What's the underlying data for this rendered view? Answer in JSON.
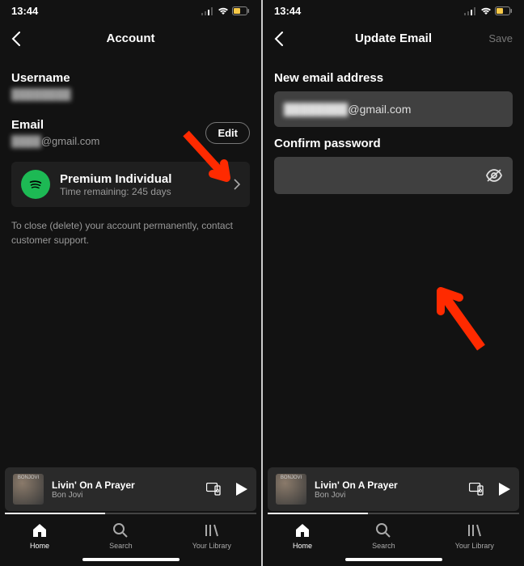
{
  "status": {
    "time": "13:44"
  },
  "left": {
    "header_title": "Account",
    "username_label": "Username",
    "username_value": "████████",
    "email_label": "Email",
    "email_value_prefix": "████",
    "email_value_suffix": "@gmail.com",
    "edit_label": "Edit",
    "plan_title": "Premium Individual",
    "plan_sub": "Time remaining: 245 days",
    "close_text": "To close (delete) your account permanently, contact customer support."
  },
  "right": {
    "header_title": "Update Email",
    "save_label": "Save",
    "new_email_label": "New email address",
    "new_email_value_prefix": "████████",
    "new_email_value_suffix": "@gmail.com",
    "confirm_label": "Confirm password"
  },
  "now_playing": {
    "song": "Livin' On A Prayer",
    "artist": "Bon Jovi",
    "art_text": "BONJOVI"
  },
  "tabs": {
    "home": "Home",
    "search": "Search",
    "library": "Your Library"
  }
}
